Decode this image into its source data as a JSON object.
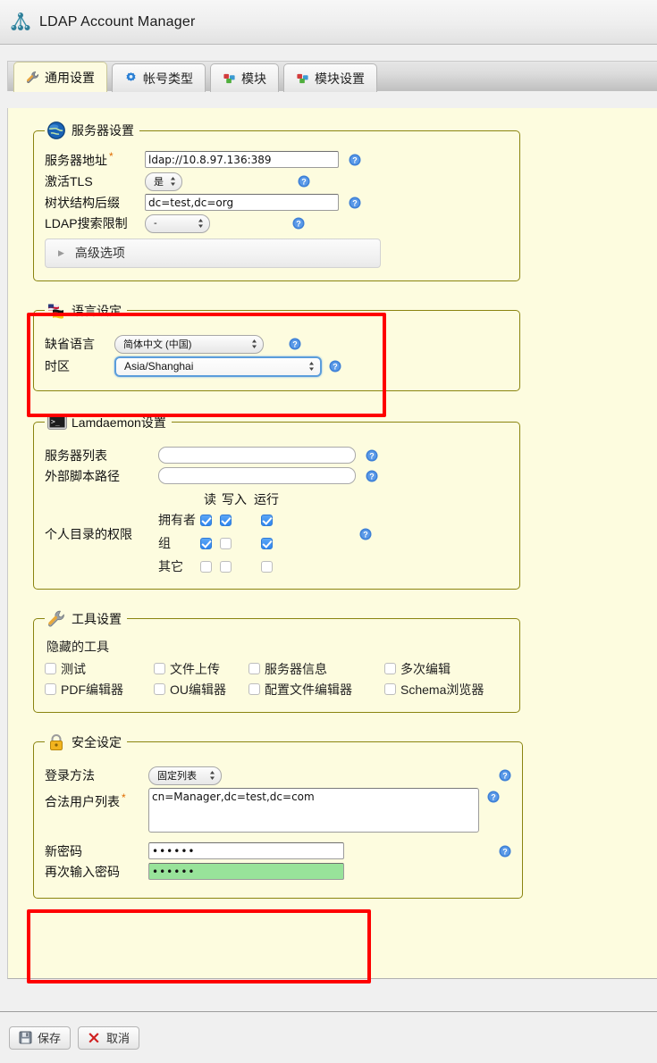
{
  "app": {
    "title": "LDAP Account Manager",
    "logo_icon": "ldap-tree-icon"
  },
  "tabs": [
    {
      "label": "通用设置",
      "icon": "wrench-icon",
      "active": true
    },
    {
      "label": "帐号类型",
      "icon": "gear-blue-icon",
      "active": false
    },
    {
      "label": "模块",
      "icon": "blocks-icon",
      "active": false
    },
    {
      "label": "模块设置",
      "icon": "blocks-icon",
      "active": false
    }
  ],
  "server_settings": {
    "legend": "服务器设置",
    "legend_icon": "globe-icon",
    "server_address": {
      "label": "服务器地址",
      "required": "*",
      "value": "ldap://10.8.97.136:389"
    },
    "activate_tls": {
      "label": "激活TLS",
      "value": "是"
    },
    "tree_suffix": {
      "label": "树状结构后缀",
      "value": "dc=test,dc=org"
    },
    "search_limit": {
      "label": "LDAP搜索限制",
      "value": "-"
    },
    "advanced": {
      "label": "高级选项",
      "icon": "triangle-right-icon"
    },
    "help_icon": "help-icon"
  },
  "language_settings": {
    "legend": "语言设定",
    "legend_icon": "flags-icon",
    "default_language": {
      "label": "缺省语言",
      "value": "简体中文 (中国)"
    },
    "timezone": {
      "label": "时区",
      "value": "Asia/Shanghai",
      "focused": true
    },
    "highlighted": true
  },
  "lamdaemon_settings": {
    "legend": "Lamdaemon设置",
    "legend_icon": "terminal-icon",
    "server_list": {
      "label": "服务器列表",
      "value": "",
      "placeholder": ""
    },
    "script_path": {
      "label": "外部脚本路径",
      "value": "",
      "placeholder": ""
    },
    "permissions": {
      "label": "个人目录的权限",
      "columns": [
        "读",
        "写入",
        "运行"
      ],
      "rows": [
        {
          "label": "拥有者",
          "checked": [
            true,
            true,
            true
          ]
        },
        {
          "label": "组",
          "checked": [
            true,
            false,
            true
          ]
        },
        {
          "label": "其它",
          "checked": [
            false,
            false,
            false
          ]
        }
      ]
    }
  },
  "tool_settings": {
    "legend": "工具设置",
    "legend_icon": "wrench-icon",
    "hidden_tools_label": "隐藏的工具",
    "tools": [
      {
        "label": "测试",
        "checked": false
      },
      {
        "label": "文件上传",
        "checked": false
      },
      {
        "label": "服务器信息",
        "checked": false
      },
      {
        "label": "多次编辑",
        "checked": false
      },
      {
        "label": "PDF编辑器",
        "checked": false
      },
      {
        "label": "OU编辑器",
        "checked": false
      },
      {
        "label": "配置文件编辑器",
        "checked": false
      },
      {
        "label": "Schema浏览器",
        "checked": false
      }
    ]
  },
  "security_settings": {
    "legend": "安全设定",
    "legend_icon": "lock-icon",
    "login_method": {
      "label": "登录方法",
      "value": "固定列表"
    },
    "valid_users": {
      "label": "合法用户列表",
      "required": "*",
      "value": "cn=Manager,dc=test,dc=com"
    },
    "new_password": {
      "label": "新密码",
      "value": "••••••"
    },
    "repeat_password": {
      "label": "再次输入密码",
      "value": "••••••",
      "state": "match"
    },
    "password_highlighted": true
  },
  "footer": {
    "save": {
      "label": "保存",
      "icon": "floppy-save-icon"
    },
    "cancel": {
      "label": "取消",
      "icon": "red-x-icon"
    }
  },
  "colors": {
    "panel_bg": "#fdfcdf",
    "fieldset_border": "#8a8410",
    "highlight": "#fe0000",
    "password_match": "#98e39a",
    "focus_blue": "#5b9ddb",
    "required_star": "#e06c00"
  }
}
